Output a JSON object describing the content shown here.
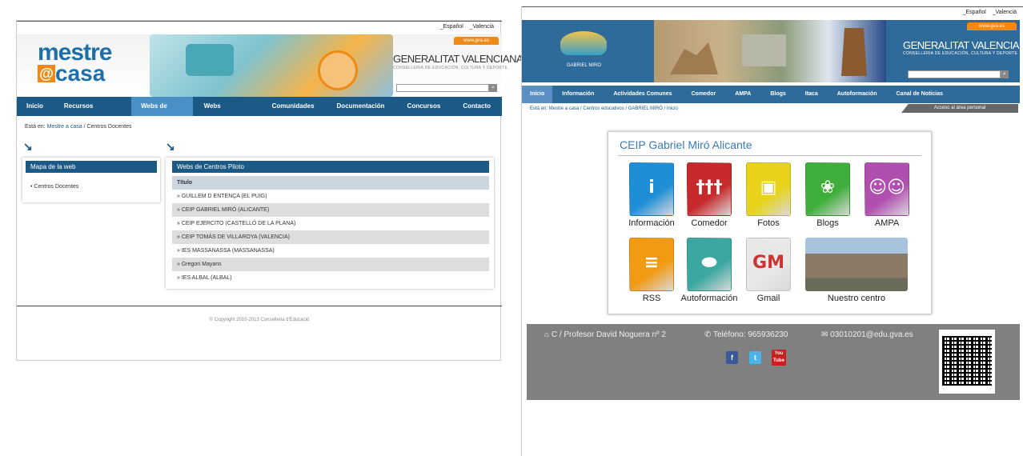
{
  "left": {
    "lang": [
      "_Español",
      "_Valencià"
    ],
    "gva": "www.gva.es",
    "logo": {
      "line1": "mestre",
      "at": "@",
      "line2": "casa"
    },
    "gv": {
      "name": "GENERALITAT VALENCIANA",
      "sub": "CONSELLERIA DE EDUCACIÓN, CULTURA Y DEPORTE"
    },
    "nav": [
      "Inicio",
      "Recursos Educativos",
      "Webs de Centro",
      "Webs Personales",
      "Comunidades",
      "Documentación",
      "Concursos",
      "Contacto"
    ],
    "crumb": {
      "prefix": "Está en:",
      "link1": "Mestre a casa",
      "sep": "/",
      "current": "Centros Docentes"
    },
    "sitemap": {
      "title": "Mapa de la web",
      "items": [
        "Centros Docentes"
      ]
    },
    "centres": {
      "title": "Webs de Centros Piloto",
      "header": "Título",
      "rows": [
        "GUILLEM D ENTENÇA (EL PUIG)",
        "CEIP GABRIEL MIRÓ (ALICANTE)",
        "CEIP EJERCITO (CASTELLÓ DE LA PLANA)",
        "CEIP TOMÁS DE VILLAROYA (VALENCIA)",
        "IES MASSANASSA (MASSANASSA)",
        "Gregori Mayans",
        "IES ALBAL (ALBAL)"
      ]
    },
    "footer": "© Copyright 2010-2013 Conselleria d'Educació"
  },
  "right": {
    "lang": [
      "_Español",
      "_Valencià"
    ],
    "gva": "www.gva.es",
    "school_logo": "GABRIEL MIRO",
    "gv": {
      "name": "GENERALITAT VALENCIANA",
      "sub": "CONSELLERIA DE EDUCACIÓN, CULTURA Y DEPORTE"
    },
    "nav": [
      "Inicio",
      "Información",
      "Actividades Comunes",
      "Comedor",
      "AMPA",
      "Blogs",
      "Itaca",
      "Autoformación",
      "Canal de Noticias"
    ],
    "crumb": "Está en:  Mestre a casa / Centros educativos / GABRIEL MIRÓ / Inicio",
    "private": "Acceso al área personal",
    "card_title": "CEIP Gabriel Miró Alicante",
    "tiles": [
      {
        "label": "Información",
        "color": "#1e8fd6",
        "icon": "info-icon",
        "glyph": "i"
      },
      {
        "label": "Comedor",
        "color": "#c72a2a",
        "icon": "cutlery-icon",
        "glyph": "†††"
      },
      {
        "label": "Fotos",
        "color": "#e8d21a",
        "icon": "camera-icon",
        "glyph": "▣"
      },
      {
        "label": "Blogs",
        "color": "#3fae3a",
        "icon": "chat-bubble-icon",
        "glyph": "❀"
      },
      {
        "label": "AMPA",
        "color": "#b04fb0",
        "icon": "people-icon",
        "glyph": "☺☺"
      },
      {
        "label": "RSS",
        "color": "#f29a12",
        "icon": "rss-icon",
        "glyph": "≡"
      },
      {
        "label": "Autoformación",
        "color": "#3aa8a0",
        "icon": "mouse-icon",
        "glyph": "⬬"
      },
      {
        "label": "Gmail",
        "color": "#e8e8e8",
        "icon": "gmail-icon",
        "glyph": "GM"
      },
      {
        "label": "Nuestro centro",
        "color": "#8a7a66",
        "icon": "school-building-photo",
        "glyph": ""
      }
    ],
    "footer": {
      "address": "C / Profesor David Noguera nº 2",
      "phone": "Teléfono: 965936230",
      "email": "03010201@edu.gva.es",
      "social": [
        "f",
        "t",
        "You Tube"
      ]
    }
  }
}
